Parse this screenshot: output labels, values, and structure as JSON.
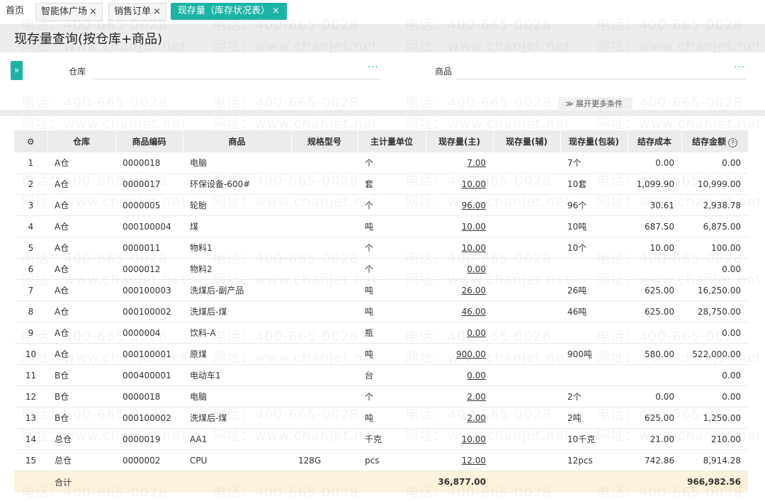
{
  "tabs": [
    {
      "label": "首页",
      "closable": false
    },
    {
      "label": "智能体广场",
      "closable": true
    },
    {
      "label": "销售订单",
      "closable": true
    },
    {
      "label": "现存量（库存状况表）",
      "closable": true
    }
  ],
  "close_glyph": "×",
  "page_title": "现存量查询(按仓库+商品)",
  "filters": {
    "expand_glyph": "»",
    "warehouse_label": "仓库",
    "product_label": "商品",
    "picker_glyph": "···",
    "more_label": "展开更多条件",
    "more_glyph": "≫"
  },
  "table": {
    "settings_icon": "⚙",
    "headers": [
      "仓库",
      "商品编码",
      "商品",
      "规格型号",
      "主计量单位",
      "现存量(主)",
      "现存量(辅)",
      "现存量(包装)",
      "结存成本",
      "结存金额"
    ],
    "help_glyph": "?",
    "rows": [
      [
        "1",
        "A仓",
        "0000018",
        "电脑",
        "",
        "个",
        "7.00",
        "",
        "7个",
        "0.00",
        "0.00"
      ],
      [
        "2",
        "A仓",
        "0000017",
        "环保设备-600#",
        "",
        "套",
        "10.00",
        "",
        "10套",
        "1,099.90",
        "10,999.00"
      ],
      [
        "3",
        "A仓",
        "0000005",
        "轮胎",
        "",
        "个",
        "96.00",
        "",
        "96个",
        "30.61",
        "2,938.78"
      ],
      [
        "4",
        "A仓",
        "000100004",
        "煤",
        "",
        "吨",
        "10.00",
        "",
        "10吨",
        "687.50",
        "6,875.00"
      ],
      [
        "5",
        "A仓",
        "0000011",
        "物料1",
        "",
        "个",
        "10.00",
        "",
        "10个",
        "10.00",
        "100.00"
      ],
      [
        "6",
        "A仓",
        "0000012",
        "物料2",
        "",
        "个",
        "0.00",
        "",
        "",
        "",
        "0.00"
      ],
      [
        "7",
        "A仓",
        "000100003",
        "洗煤后-副产品",
        "",
        "吨",
        "26.00",
        "",
        "26吨",
        "625.00",
        "16,250.00"
      ],
      [
        "8",
        "A仓",
        "000100002",
        "洗煤后-煤",
        "",
        "吨",
        "46.00",
        "",
        "46吨",
        "625.00",
        "28,750.00"
      ],
      [
        "9",
        "A仓",
        "0000004",
        "饮料-A",
        "",
        "瓶",
        "0.00",
        "",
        "",
        "",
        "0.00"
      ],
      [
        "10",
        "A仓",
        "000100001",
        "原煤",
        "",
        "吨",
        "900.00",
        "",
        "900吨",
        "580.00",
        "522,000.00"
      ],
      [
        "11",
        "B仓",
        "000400001",
        "电动车1",
        "",
        "台",
        "0.00",
        "",
        "",
        "",
        "0.00"
      ],
      [
        "12",
        "B仓",
        "0000018",
        "电脑",
        "",
        "个",
        "2.00",
        "",
        "2个",
        "0.00",
        "0.00"
      ],
      [
        "13",
        "B仓",
        "000100002",
        "洗煤后-煤",
        "",
        "吨",
        "2.00",
        "",
        "2吨",
        "625.00",
        "1,250.00"
      ],
      [
        "14",
        "总仓",
        "0000019",
        "AA1",
        "",
        "千克",
        "10.00",
        "",
        "10千克",
        "21.00",
        "210.00"
      ],
      [
        "15",
        "总仓",
        "0000002",
        "CPU",
        "128G",
        "pcs",
        "12.00",
        "",
        "12pcs",
        "742.86",
        "8,914.28"
      ]
    ],
    "total": {
      "label": "合计",
      "qty_main": "36,877.00",
      "amount": "966,982.56"
    }
  },
  "watermark": {
    "phone": "电话：400-665-0028",
    "url": "网址：www.chanjet.net"
  }
}
